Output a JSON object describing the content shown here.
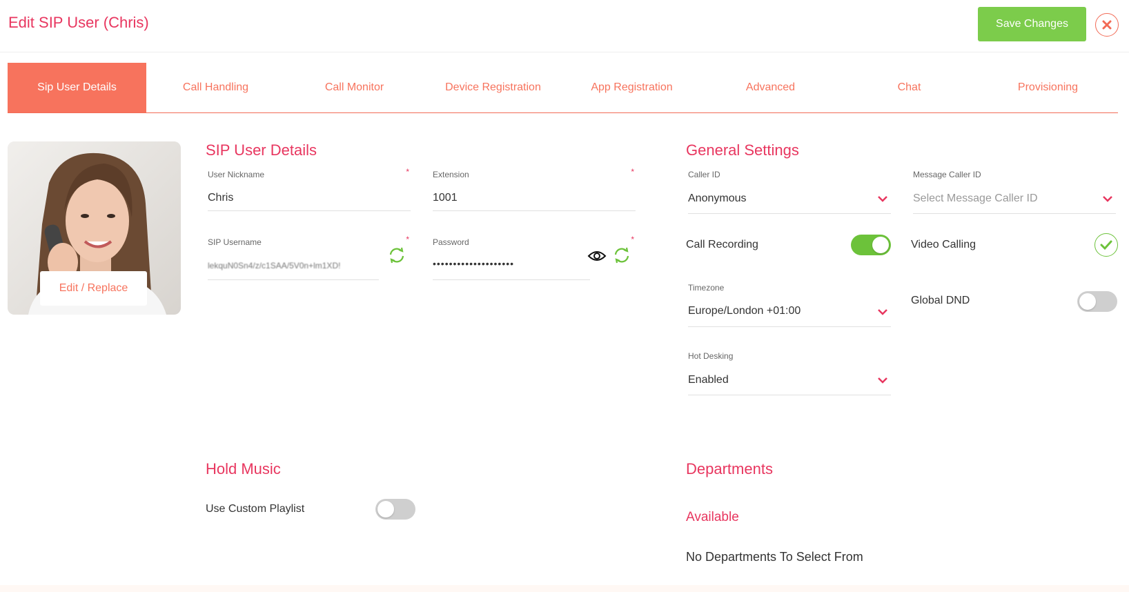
{
  "header": {
    "title": "Edit SIP User (Chris)",
    "save_label": "Save Changes"
  },
  "tabs": [
    {
      "label": "Sip User Details",
      "active": true
    },
    {
      "label": "Call Handling"
    },
    {
      "label": "Call Monitor"
    },
    {
      "label": "Device Registration"
    },
    {
      "label": "App Registration"
    },
    {
      "label": "Advanced"
    },
    {
      "label": "Chat"
    },
    {
      "label": "Provisioning"
    }
  ],
  "avatar": {
    "edit_label": "Edit / Replace"
  },
  "sip_details": {
    "title": "SIP User Details",
    "nickname_label": "User Nickname",
    "nickname_value": "Chris",
    "extension_label": "Extension",
    "extension_value": "1001",
    "username_label": "SIP Username",
    "username_value": "lekquN0Sn4/z/c1SAA/5V0n+lm1XD!",
    "password_label": "Password",
    "password_value": "••••••••••••••••••••",
    "required_mark": "*"
  },
  "general": {
    "title": "General Settings",
    "caller_id_label": "Caller ID",
    "caller_id_value": "Anonymous",
    "msg_caller_id_label": "Message Caller ID",
    "msg_caller_id_placeholder": "Select Message Caller ID",
    "call_recording_label": "Call Recording",
    "call_recording_on": true,
    "video_calling_label": "Video Calling",
    "video_calling_on": true,
    "timezone_label": "Timezone",
    "timezone_value": "Europe/London +01:00",
    "global_dnd_label": "Global DND",
    "global_dnd_on": false,
    "hot_desking_label": "Hot Desking",
    "hot_desking_value": "Enabled"
  },
  "hold_music": {
    "title": "Hold Music",
    "custom_playlist_label": "Use Custom Playlist",
    "custom_playlist_on": false
  },
  "departments": {
    "title": "Departments",
    "available_label": "Available",
    "empty_text": "No Departments To Select From"
  },
  "colors": {
    "accent": "#e8365f",
    "tab_active": "#f7735d",
    "save": "#7ccc4b",
    "toggle_on": "#6cc23a",
    "toggle_off": "#cfcfcf"
  }
}
